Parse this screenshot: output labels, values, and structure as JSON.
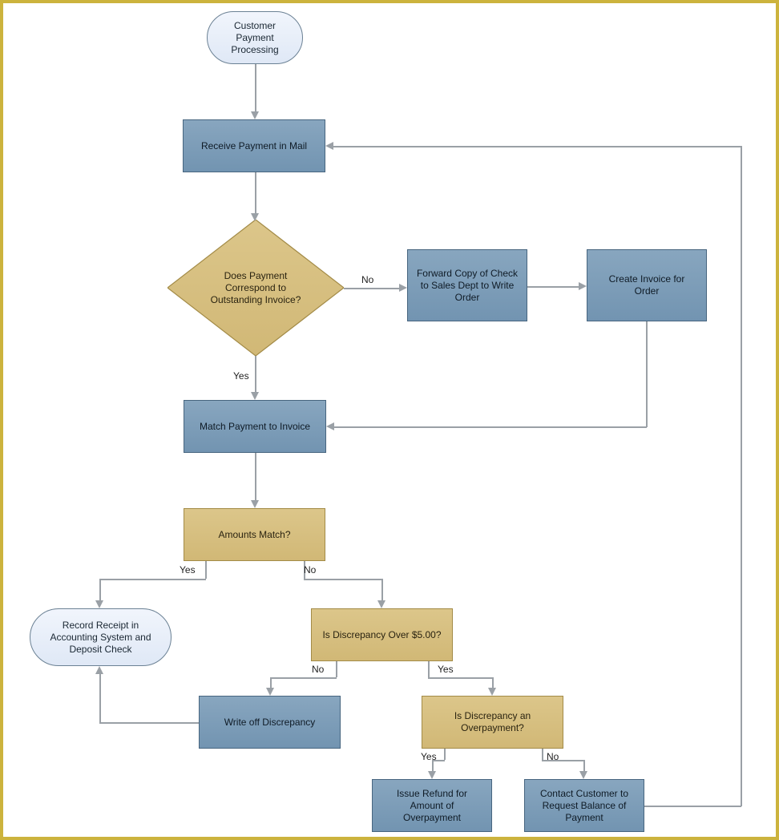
{
  "nodes": {
    "start": "Customer Payment Processing",
    "receive": "Receive Payment in Mail",
    "correspond": "Does Payment Correspond to Outstanding Invoice?",
    "forward": "Forward Copy of Check to Sales Dept to Write Order",
    "createInvoice": "Create Invoice for Order",
    "match": "Match Payment to Invoice",
    "amountsMatch": "Amounts Match?",
    "record": "Record Receipt in Accounting System and Deposit Check",
    "discrepancyOver": "Is Discrepancy Over $5.00?",
    "writeOff": "Write off Discrepancy",
    "overpayment": "Is Discrepancy an Overpayment?",
    "issueRefund": "Issue Refund for Amount of Overpayment",
    "contactCustomer": "Contact Customer to Request Balance of Payment"
  },
  "labels": {
    "yes": "Yes",
    "no": "No"
  }
}
